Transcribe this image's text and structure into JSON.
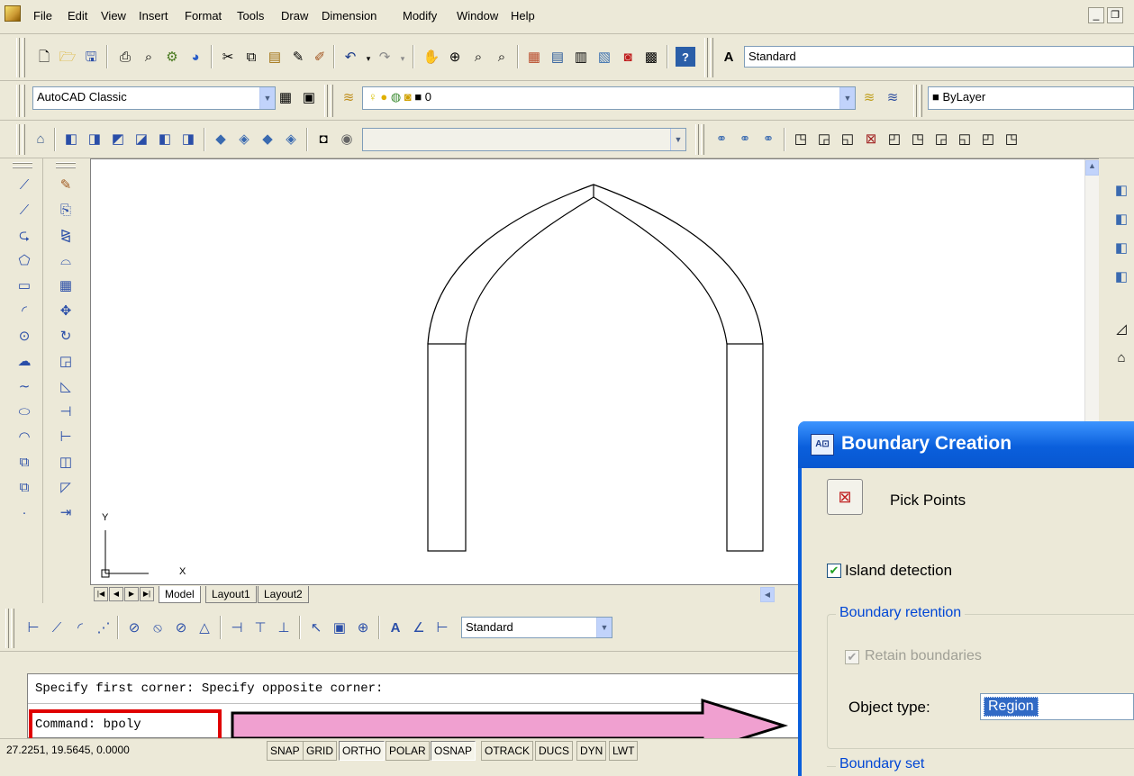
{
  "menu": {
    "items": [
      "File",
      "Edit",
      "View",
      "Insert",
      "Format",
      "Tools",
      "Draw",
      "Dimension",
      "Modify",
      "Window",
      "Help"
    ]
  },
  "toolbar_top": {
    "text_style": "Standard"
  },
  "workspace": {
    "name": "AutoCAD Classic",
    "layer": "0",
    "color": "ByLayer"
  },
  "tabs": [
    "Model",
    "Layout1",
    "Layout2"
  ],
  "dim_toolbar": {
    "dim_style": "Standard"
  },
  "ucs": {
    "x_label": "X",
    "y_label": "Y"
  },
  "command_line": {
    "history": "Specify first corner: Specify opposite corner:",
    "current": "Command: bpoly"
  },
  "status_bar": {
    "coords": "27.2251, 19.5645, 0.0000",
    "toggles": [
      "SNAP",
      "GRID",
      "ORTHO",
      "POLAR",
      "OSNAP",
      "OTRACK",
      "DUCS",
      "DYN",
      "LWT"
    ]
  },
  "dialog": {
    "title": "Boundary Creation",
    "pick_points": "Pick Points",
    "island_detection": "Island detection",
    "boundary_retention": "Boundary retention",
    "retain_boundaries": "Retain boundaries",
    "object_type_label": "Object type:",
    "object_type_value": "Region",
    "boundary_set": "Boundary set"
  },
  "colors": {
    "arrow_fill": "#f0a0d0",
    "highlight_box": "#e00000",
    "title_blue": "#0a5fdc"
  }
}
